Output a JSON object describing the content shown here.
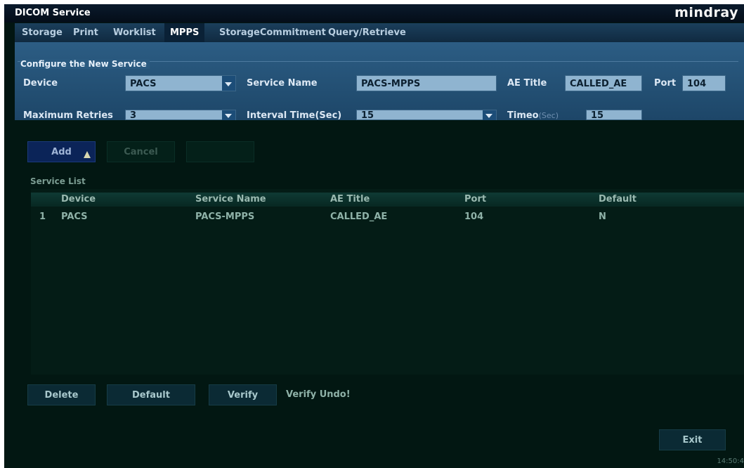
{
  "window": {
    "title": "DICOM Service",
    "brand": "mindray"
  },
  "tabs": [
    {
      "label": "Storage"
    },
    {
      "label": "Print"
    },
    {
      "label": "Worklist"
    },
    {
      "label": "MPPS",
      "active": true
    },
    {
      "label": "StorageCommitment"
    },
    {
      "label": "Query/Retrieve"
    }
  ],
  "config": {
    "group_label": "Configure the New Service",
    "device": {
      "label": "Device",
      "value": "PACS"
    },
    "service_name": {
      "label": "Service Name",
      "value": "PACS-MPPS"
    },
    "ae_title": {
      "label": "AE Title",
      "value": "CALLED_AE"
    },
    "port": {
      "label": "Port",
      "value": "104"
    },
    "max_retries": {
      "label": "Maximum Retries",
      "value": "3"
    },
    "interval_time": {
      "label": "Interval Time(Sec)",
      "value": "15"
    },
    "timeout": {
      "label": "Timeo",
      "label_suffix": "(Sec)",
      "value": "15"
    }
  },
  "actions": {
    "add": "Add",
    "cancel": "Cancel"
  },
  "service_list": {
    "label": "Service List",
    "columns": [
      "Device",
      "Service Name",
      "AE Title",
      "Port",
      "Default"
    ],
    "rows": [
      {
        "index": "1",
        "device": "PACS",
        "service_name": "PACS-MPPS",
        "ae_title": "CALLED_AE",
        "port": "104",
        "default": "N"
      }
    ]
  },
  "bottom": {
    "delete": "Delete",
    "default": "Default",
    "verify": "Verify",
    "status": "Verify Undo!",
    "exit": "Exit"
  },
  "clock": "14:50:4"
}
